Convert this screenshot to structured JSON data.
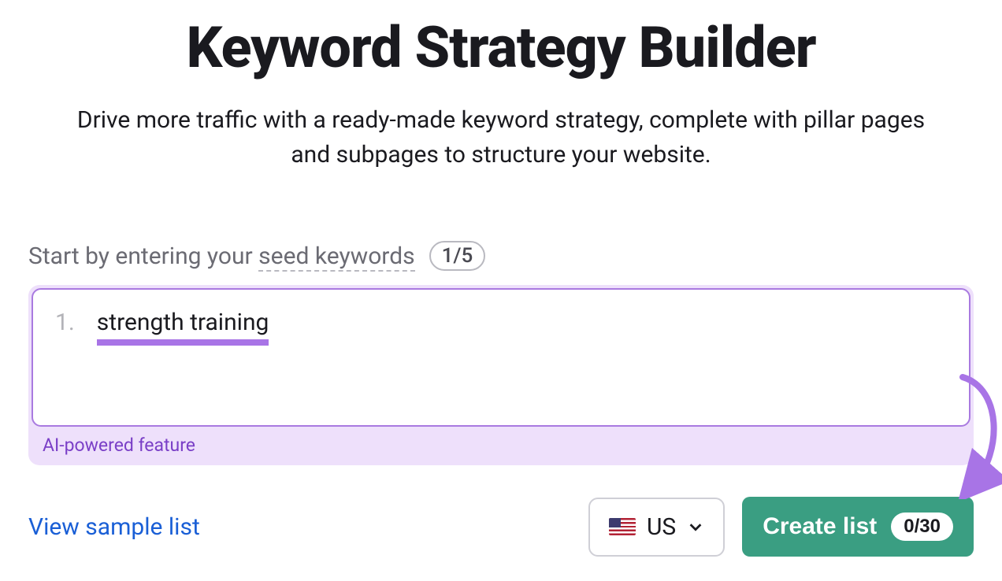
{
  "header": {
    "title": "Keyword Strategy Builder",
    "subtitle": "Drive more traffic with a ready-made keyword strategy, complete with pillar pages and subpages to structure your website."
  },
  "prompt": {
    "prefix": "Start by entering your ",
    "seed_label": "seed keywords",
    "count": "1/5"
  },
  "input": {
    "row_number": "1.",
    "keyword": "strength training",
    "ai_caption": "AI-powered feature"
  },
  "footer": {
    "view_sample": "View sample list",
    "country_code": "US",
    "create_label": "Create list",
    "create_badge": "0/30"
  }
}
